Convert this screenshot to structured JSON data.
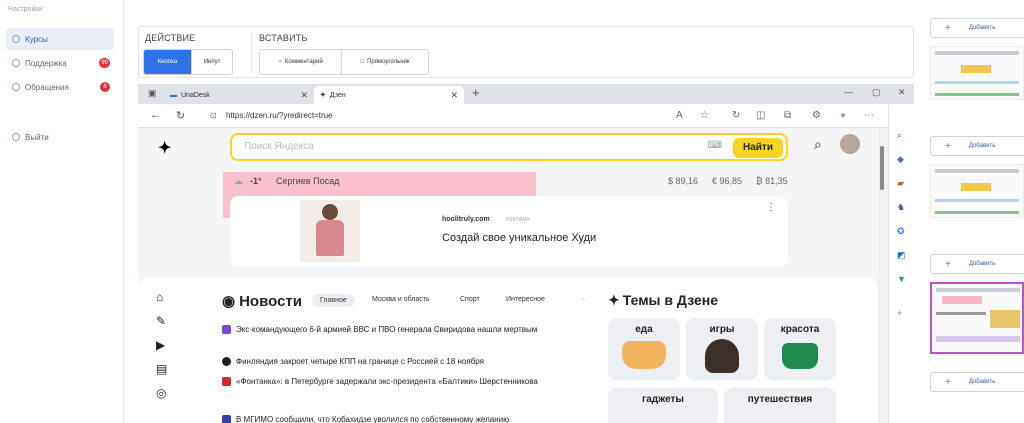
{
  "sidebar": {
    "top_text": "Настройки",
    "items": [
      {
        "label": "Курсы",
        "icon": "courses-icon",
        "badge": null
      },
      {
        "label": "Поддержка",
        "icon": "support-icon",
        "badge": "99"
      },
      {
        "label": "Обращения",
        "icon": "tickets-icon",
        "badge": "8"
      }
    ],
    "logout_label": "Выйти"
  },
  "toolbar": {
    "action_title": "ДЕЙСТВИЕ",
    "action_buttons": [
      "Кнопка",
      "Инпут"
    ],
    "insert_title": "ВСТАВИТЬ",
    "insert_buttons": [
      "Комментарий",
      "Прямоугольник"
    ]
  },
  "browser": {
    "tabs": [
      {
        "label": "UnaDesk",
        "icon": "unadesk-icon"
      },
      {
        "label": "Дзен",
        "icon": "dzen-icon"
      }
    ],
    "new_tab": "+",
    "url": "https://dzen.ru/?yredirect=true"
  },
  "page": {
    "search_placeholder": "Поиск Яндекса",
    "search_button": "Найти",
    "weather_temp": "-1°",
    "city": "Сергиев Посад",
    "rates": [
      "$ 89,16",
      "€ 96,85",
      "₿ 81,35"
    ],
    "ad": {
      "domain": "hoolitruly.com",
      "badge": "РЕКЛАМА",
      "title": "Создай свое уникальное Худи"
    },
    "news": {
      "title": "Новости",
      "tabs": [
        "Главное",
        "Москва и область",
        "Спорт",
        "Интересное"
      ],
      "items": [
        {
          "text": "Экс-командующего 6-й армией ВВС и ПВО генерала Свиридова нашли мертвым",
          "color": "#7a4bd0"
        },
        {
          "text": "Финляндия закроет четыре КПП на границе с Россией с 18 ноября",
          "color": "#222222"
        },
        {
          "text": "«Фонтанка»: в Петербурге задержали экс-президента «Балтики» Шерстенникова",
          "color": "#d42a2a"
        },
        {
          "text": "В МГИМО сообщили, что Кобахидзе уволился по собственному желанию",
          "color": "#3b3bb0"
        }
      ]
    },
    "topics": {
      "title": "Темы в Дзене",
      "items": [
        "еда",
        "игры",
        "красота",
        "гаджеты",
        "путешествия"
      ]
    }
  },
  "panel": {
    "add_label": "Добавить"
  }
}
